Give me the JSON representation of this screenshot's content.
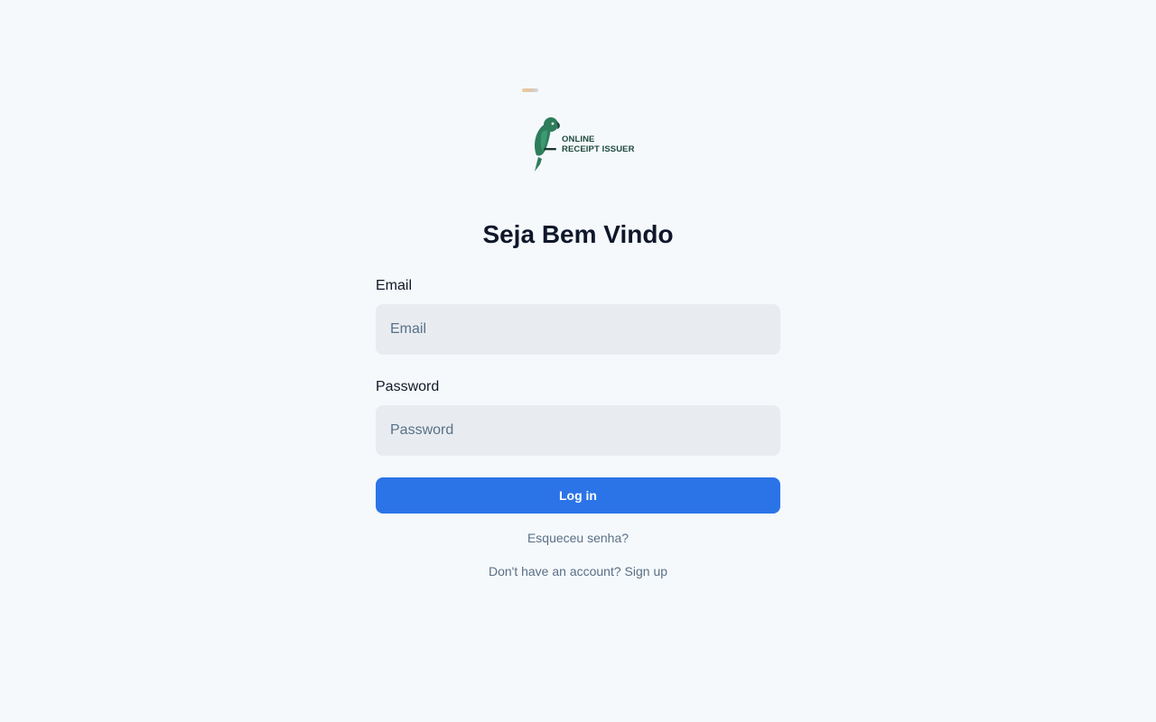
{
  "logo": {
    "line1": "ONLINE",
    "line2": "RECEIPT ISSUER",
    "brand_color": "#2e7d5b"
  },
  "title": "Seja Bem Vindo",
  "form": {
    "email": {
      "label": "Email",
      "placeholder": "Email",
      "value": ""
    },
    "password": {
      "label": "Password",
      "placeholder": "Password",
      "value": ""
    },
    "submit_label": "Log in"
  },
  "links": {
    "forgot_password": "Esqueceu senha?",
    "signup_prompt": "Don't have an account?",
    "signup_link": "Sign up"
  },
  "colors": {
    "background": "#f5f9fc",
    "accent": "#2b74e8",
    "input_bg": "#e8ecf0",
    "muted_text": "#5a6f86"
  }
}
